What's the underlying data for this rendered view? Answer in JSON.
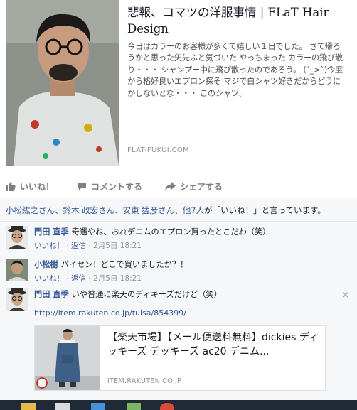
{
  "share": {
    "title": "悲報、コマツの洋服事情 | FLaT Hair Design",
    "description": "今日はカラーのお客様が多くて嬉しい１日でした。 さて帰ろうかと思った矢先ふと気づいた やっちまった カラーの飛び散り・・・ シャンプー中に飛び散ったのであろう。 (´_>`)今度から格好良いエプロン探そ マジで白シャツ好きだからどうにかしないとな・・・ このシャツ、",
    "domain": "FLAT-FUKUI.COM"
  },
  "actions": {
    "like": "いいね！",
    "comment": "コメントする",
    "share": "シェアする"
  },
  "likes_summary": {
    "names": "小松紘之さん、鈴木 政宏さん、安東 猛彦さん、他7人",
    "suffix": "が「いいね！」と言っています。"
  },
  "comments": [
    {
      "author": "門田 直季",
      "text": "奇遇やね、おれデニムのエプロン買ったとこだわ（笑）",
      "like": "いいね！",
      "reply": "返信",
      "time": "2月5日 18:21"
    },
    {
      "author": "小松樹",
      "text": "パイセン！どこで買いましたか？！",
      "like": "いいね！",
      "reply": "返信",
      "time": "2月5日 18:21"
    },
    {
      "author": "門田 直季",
      "text": "いや普通に楽天のディキーズだけど（笑）",
      "url": "http://item.rakuten.co.jp/tulsa/854399/",
      "preview": {
        "title": "【楽天市場】【メール便送料無料】dickies ディッキーズ デッキーズ ac20 デニム...",
        "domain": "ITEM.RAKUTEN.CO.JP"
      }
    }
  ],
  "icons": [
    "thumbs-up-icon",
    "comment-icon",
    "share-arrow-icon",
    "close-icon"
  ],
  "colors": {
    "link": "#365899",
    "meta": "#90949c",
    "taskbar": "#1f2a36"
  }
}
